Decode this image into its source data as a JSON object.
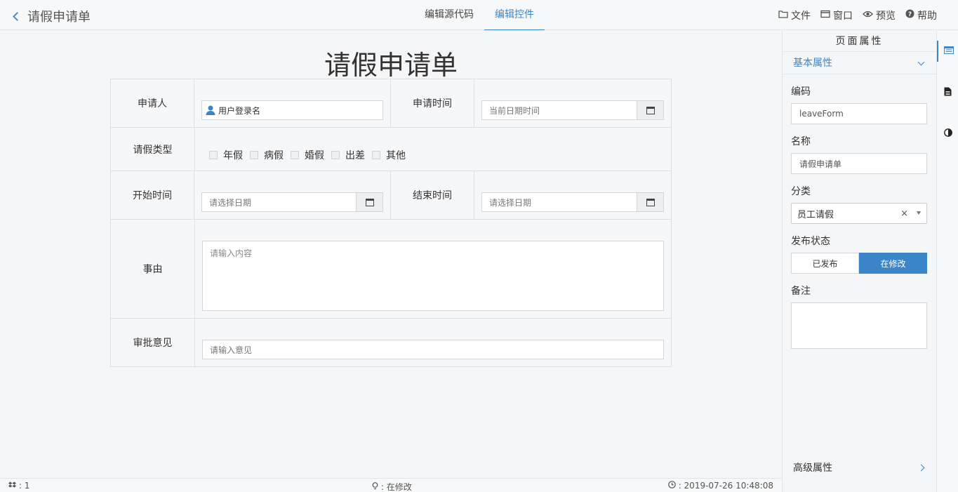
{
  "header": {
    "title": "请假申请单",
    "tabs": [
      {
        "label": "编辑源代码"
      },
      {
        "label": "编辑控件",
        "active": true
      }
    ],
    "actions": [
      {
        "label": "文件",
        "icon": "folder-icon"
      },
      {
        "label": "窗口",
        "icon": "window-icon"
      },
      {
        "label": "预览",
        "icon": "eye-icon"
      },
      {
        "label": "帮助",
        "icon": "help-icon"
      }
    ]
  },
  "form": {
    "title": "请假申请单",
    "applicant_label": "申请人",
    "applicant_value": "用户登录名",
    "apply_time_label": "申请时间",
    "apply_time_placeholder": "当前日期时间",
    "leave_type_label": "请假类型",
    "leave_types": [
      "年假",
      "病假",
      "婚假",
      "出差",
      "其他"
    ],
    "start_time_label": "开始时间",
    "start_time_placeholder": "请选择日期",
    "end_time_label": "结束时间",
    "end_time_placeholder": "请选择日期",
    "reason_label": "事由",
    "reason_placeholder": "请输入内容",
    "opinion_label": "审批意见",
    "opinion_placeholder": "请输入意见"
  },
  "status": {
    "count": "1",
    "state": "在修改",
    "time": "2019-07-26 10:48:08"
  },
  "panel": {
    "title": "页面属性",
    "section_basic": "基本属性",
    "code_label": "编码",
    "code_value": "leaveForm",
    "name_label": "名称",
    "name_value": "请假申请单",
    "category_label": "分类",
    "category_value": "员工请假",
    "publish_label": "发布状态",
    "publish_options": [
      "已发布",
      "在修改"
    ],
    "publish_selected": "在修改",
    "remark_label": "备注",
    "section_advanced": "高级属性"
  },
  "colors": {
    "accent": "#3a86c8",
    "border": "#dcdfe3"
  }
}
